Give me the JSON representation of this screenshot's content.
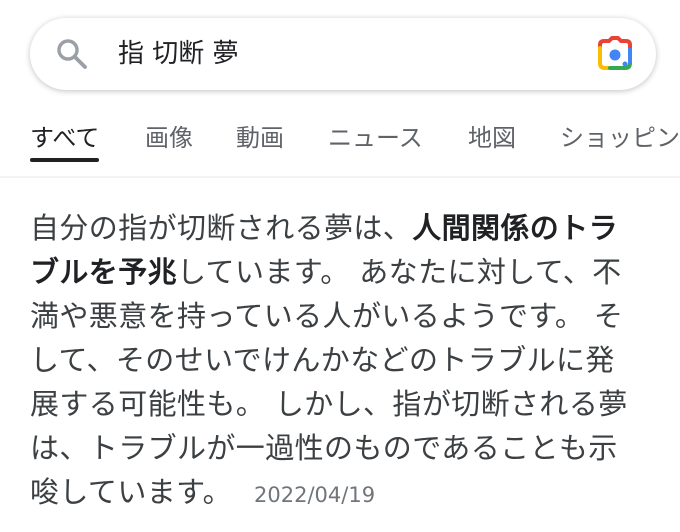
{
  "search": {
    "query": "指 切断 夢",
    "icons": {
      "search": "search-icon",
      "lens": "google-lens-camera-icon"
    },
    "colors": {
      "lens_blue": "#4285f4",
      "lens_red": "#ea4335",
      "lens_yellow": "#fbbc04",
      "lens_green": "#34a853"
    }
  },
  "tabs": [
    {
      "label": "すべて",
      "active": true
    },
    {
      "label": "画像"
    },
    {
      "label": "動画"
    },
    {
      "label": "ニュース"
    },
    {
      "label": "地図"
    },
    {
      "label": "ショッピング"
    }
  ],
  "snippet": {
    "before": "自分の指が切断される夢は、",
    "bold": "人間関係のトラブルを予兆",
    "after": "しています。 あなたに対して、不満や悪意を持っている人がいるようです。 そして、そのせいでけんかなどのトラブルに発展する可能性も。 しかし、指が切断される夢は、トラブルが一過性のものであることも示唆しています。",
    "date": "2022/04/19"
  }
}
